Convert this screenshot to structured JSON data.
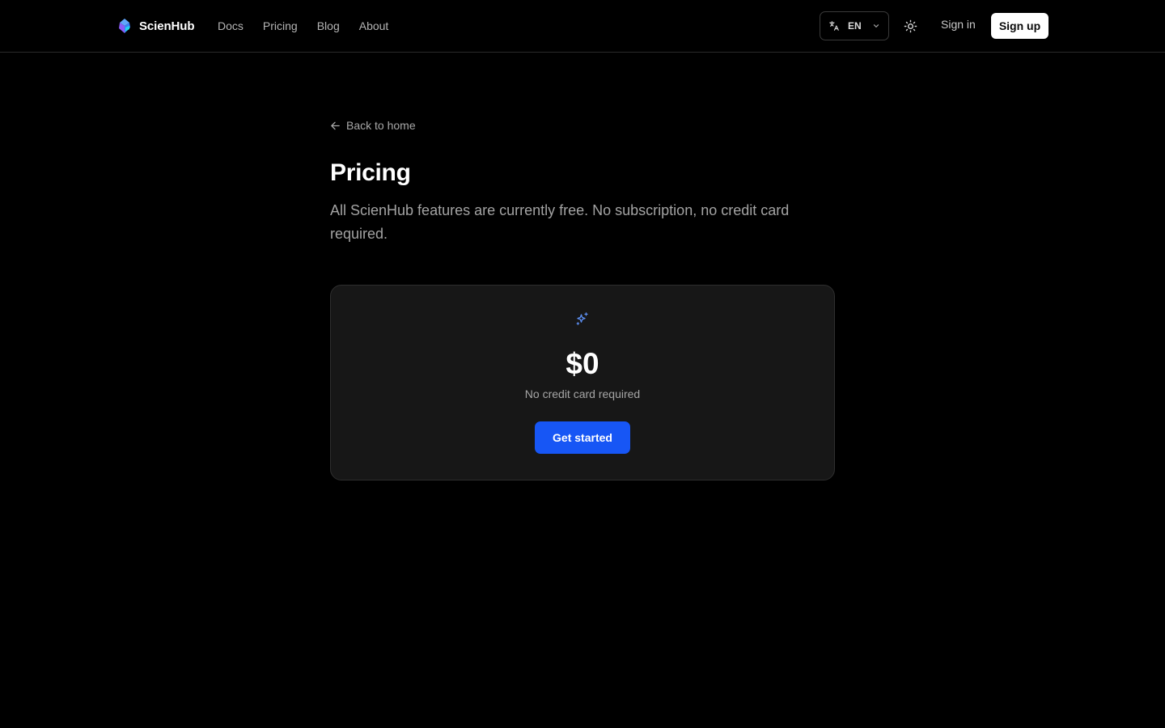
{
  "brand": {
    "name": "ScienHub",
    "logo_icon": "scienhub-logo-icon",
    "logo_colors": [
      "#3b82f6",
      "#8b5cf6",
      "#22d3ee"
    ]
  },
  "nav": {
    "items": [
      {
        "label": "Docs"
      },
      {
        "label": "Pricing"
      },
      {
        "label": "Blog"
      },
      {
        "label": "About"
      }
    ]
  },
  "header": {
    "language": {
      "icon": "translate-icon",
      "value": "EN",
      "chevron_icon": "chevron-down-icon"
    },
    "theme_toggle_icon": "sun-icon",
    "sign_in_label": "Sign in",
    "sign_up_label": "Sign up"
  },
  "main": {
    "back_link": {
      "icon": "arrow-left-icon",
      "label": "Back to home"
    },
    "title": "Pricing",
    "subtitle": "All ScienHub features are currently free. No subscription, no credit card required.",
    "card": {
      "icon": "sparkles-icon",
      "price": "$0",
      "note": "No credit card required",
      "cta_label": "Get started"
    }
  },
  "colors": {
    "background": "#000000",
    "card_background": "#171717",
    "accent": "#1756f5",
    "icon_accent": "#5b8def"
  }
}
